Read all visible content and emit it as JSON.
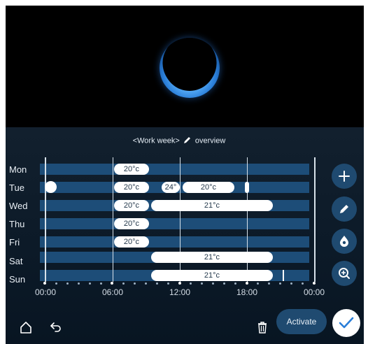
{
  "header": {
    "title_open": "<Work week>",
    "title_rest": "overview"
  },
  "days": [
    {
      "label": "Mon"
    },
    {
      "label": "Tue"
    },
    {
      "label": "Wed"
    },
    {
      "label": "Thu"
    },
    {
      "label": "Fri"
    },
    {
      "label": "Sat"
    },
    {
      "label": "Sun"
    }
  ],
  "slots": {
    "mon_1": "20°c",
    "tue_1": "20°c",
    "tue_2": "24°",
    "tue_3": "20°c",
    "wed_1": "20°c",
    "wed_2": "21°c",
    "thu_1": "20°c",
    "fri_1": "20°c",
    "sat_1": "21°c",
    "sun_1": "21°c"
  },
  "timeline": {
    "labels": [
      "00:00",
      "06:00",
      "12:00",
      "18:00",
      "00:00"
    ]
  },
  "side_actions": [
    {
      "icon": "plus-icon"
    },
    {
      "icon": "pencil-icon"
    },
    {
      "icon": "drop-settings-icon"
    },
    {
      "icon": "zoom-icon"
    }
  ],
  "footer": {
    "home_icon": "home-icon",
    "back_icon": "back-arrow-icon",
    "delete_icon": "trash-icon",
    "activate_label": "Activate",
    "confirm_icon": "checkmark-icon"
  },
  "colors": {
    "track": "#1d4d78",
    "panel": "#0c1a28",
    "button": "#1f4a70",
    "accent": "#2a7ed8",
    "confirm_check": "#2a7ed8"
  }
}
